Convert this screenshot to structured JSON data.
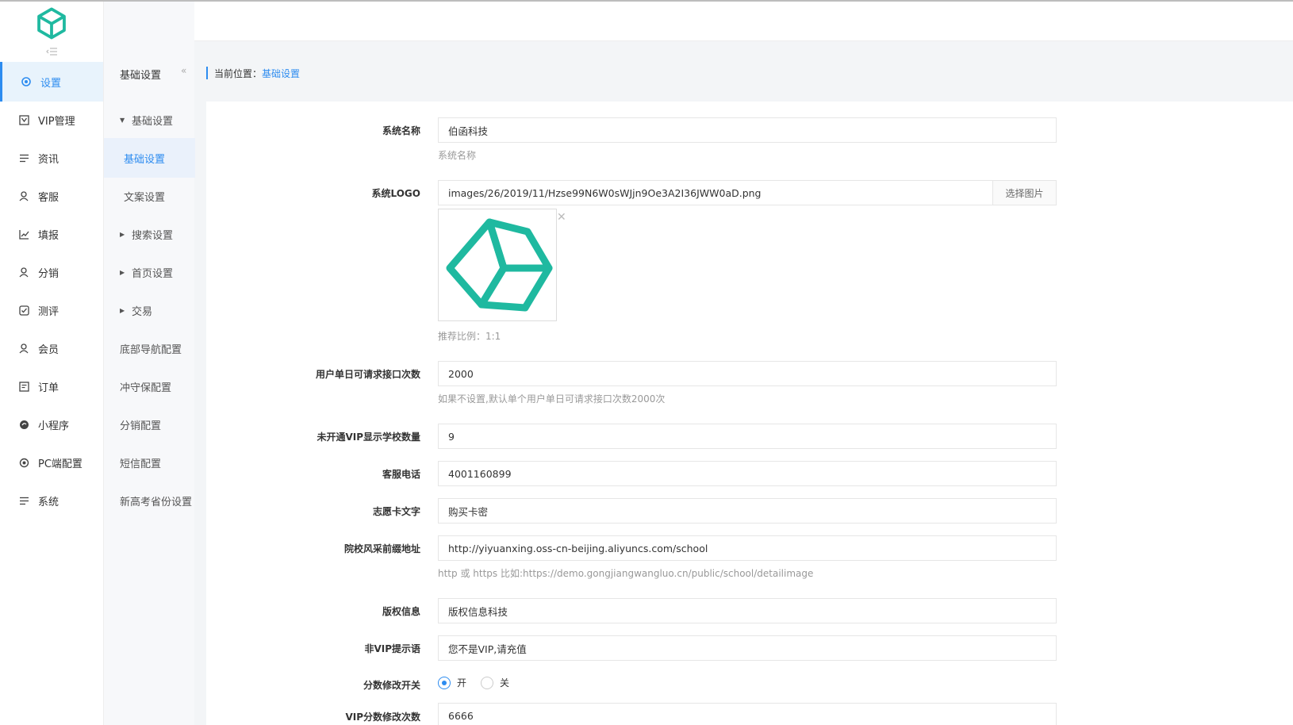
{
  "header": {
    "home_icon": "home-icon",
    "menu_icon": "menu-icon"
  },
  "sidebar": {
    "items": [
      {
        "label": "设置",
        "icon": "gear-icon",
        "active": true
      },
      {
        "label": "VIP管理",
        "icon": "vip-icon"
      },
      {
        "label": "资讯",
        "icon": "list-icon"
      },
      {
        "label": "客服",
        "icon": "user-icon"
      },
      {
        "label": "填报",
        "icon": "chart-icon"
      },
      {
        "label": "分销",
        "icon": "user-icon"
      },
      {
        "label": "测评",
        "icon": "check-icon"
      },
      {
        "label": "会员",
        "icon": "user-icon"
      },
      {
        "label": "订单",
        "icon": "order-icon"
      },
      {
        "label": "小程序",
        "icon": "miniapp-icon"
      },
      {
        "label": "PC端配置",
        "icon": "gear-icon"
      },
      {
        "label": "系统",
        "icon": "list-icon"
      }
    ]
  },
  "subnav": {
    "title": "基础设置",
    "items": [
      {
        "label": "基础设置",
        "expanded": true
      },
      {
        "label": "基础设置",
        "active": true
      },
      {
        "label": "文案设置"
      },
      {
        "label": "搜索设置"
      },
      {
        "label": "首页设置"
      },
      {
        "label": "交易"
      },
      {
        "label": "底部导航配置"
      },
      {
        "label": "冲守保配置"
      },
      {
        "label": "分销配置"
      },
      {
        "label": "短信配置"
      },
      {
        "label": "新高考省份设置"
      }
    ]
  },
  "breadcrumb": {
    "prefix": "当前位置：",
    "current": "基础设置"
  },
  "form": {
    "system_name": {
      "label": "系统名称",
      "value": "伯函科技",
      "help": "系统名称"
    },
    "system_logo": {
      "label": "系统LOGO",
      "value": "images/26/2019/11/Hzse99N6W0sWJjn9Oe3A2I36JWW0aD.png",
      "button": "选择图片",
      "help": "推荐比例：1:1"
    },
    "daily_limit": {
      "label": "用户单日可请求接口次数",
      "value": "2000",
      "help": "如果不设置,默认单个用户单日可请求接口次数2000次"
    },
    "non_vip_schools": {
      "label": "未开通VIP显示学校数量",
      "value": "9"
    },
    "service_phone": {
      "label": "客服电话",
      "value": "4001160899"
    },
    "card_text": {
      "label": "志愿卡文字",
      "value": "购买卡密"
    },
    "school_prefix": {
      "label": "院校风采前缀地址",
      "value": "http://yiyuanxing.oss-cn-beijing.aliyuncs.com/school",
      "help": "http 或 https 比如:https://demo.gongjiangwangluo.cn/public/school/detailimage"
    },
    "copyright": {
      "label": "版权信息",
      "value": "版权信息科技"
    },
    "non_vip_tip": {
      "label": "非VIP提示语",
      "value": "您不是VIP,请充值"
    },
    "score_switch": {
      "label": "分数修改开关",
      "on": "开",
      "off": "关",
      "selected": "开"
    },
    "vip_score_times": {
      "label": "VIP分数修改次数",
      "value": "6666"
    }
  },
  "colors": {
    "accent": "#2d8cf0",
    "logo": "#1fb9a0"
  }
}
